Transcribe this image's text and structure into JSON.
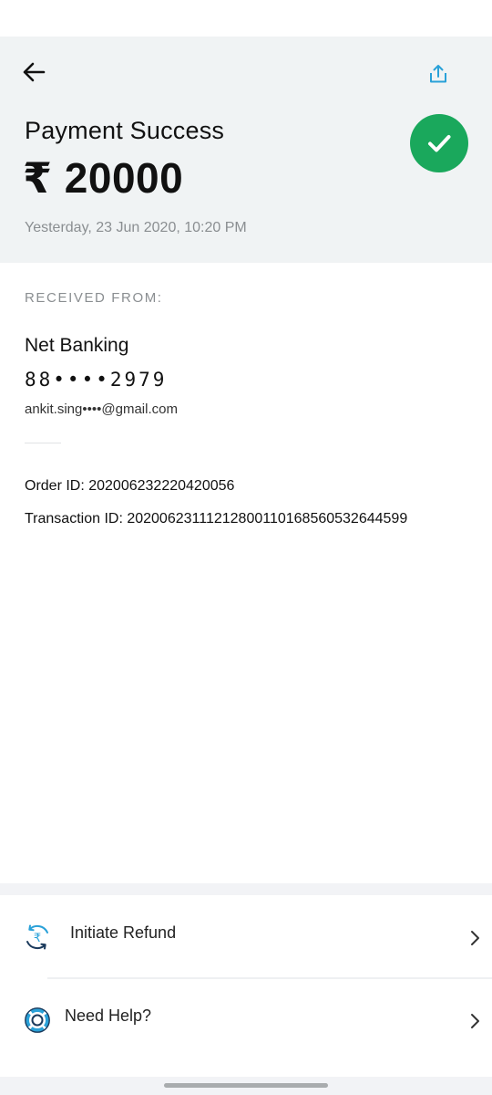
{
  "header": {
    "title": "Payment Success",
    "amount": "₹ 20000",
    "datetime": "Yesterday, 23 Jun 2020, 10:20 PM",
    "back_icon": "arrow-left-icon",
    "share_icon": "share-icon",
    "status_icon": "check-circle-icon",
    "status_color": "#1aa85c",
    "accent_color": "#2aa1d8"
  },
  "received_from": {
    "label": "RECEIVED FROM:",
    "name": "Net Banking",
    "account": "88••••2979",
    "email": "ankit.sing••••@gmail.com"
  },
  "ids": {
    "order_id": "Order ID: 202006232220420056",
    "transaction_id": "Transaction ID: 20200623111212800110168560532644599"
  },
  "actions": [
    {
      "label": "Initiate Refund",
      "icon": "rupee-refund-icon"
    },
    {
      "label": "Need Help?",
      "icon": "lifebuoy-icon"
    }
  ]
}
